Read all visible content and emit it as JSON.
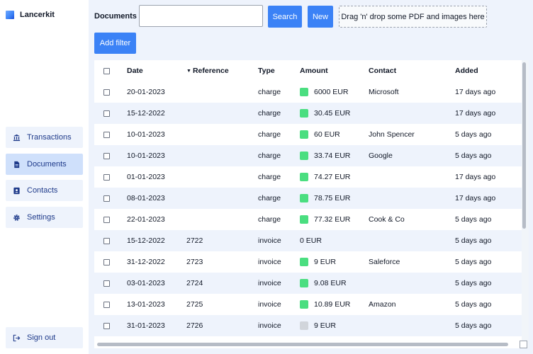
{
  "app": {
    "name": "Lancerkit"
  },
  "sidebar": {
    "items": [
      {
        "label": "Transactions",
        "icon": "bank-icon",
        "active": false
      },
      {
        "label": "Documents",
        "icon": "document-icon",
        "active": true
      },
      {
        "label": "Contacts",
        "icon": "contact-card-icon",
        "active": false
      },
      {
        "label": "Settings",
        "icon": "gear-icon",
        "active": false
      }
    ],
    "signout": {
      "label": "Sign out",
      "icon": "sign-out-icon"
    }
  },
  "toolbar": {
    "title": "Documents",
    "search_value": "",
    "search_label": "Search",
    "new_label": "New",
    "dropzone_text": "Drag 'n' drop some PDF and images here",
    "filter_label": "Add filter"
  },
  "table": {
    "columns": [
      "Date",
      "Reference",
      "Type",
      "Amount",
      "Contact",
      "Added"
    ],
    "sorted_column": "Reference",
    "rows": [
      {
        "date": "20-01-2023",
        "reference": "",
        "type": "charge",
        "amount": "6000 EUR",
        "status": "green",
        "contact": "Microsoft",
        "added": "17 days ago"
      },
      {
        "date": "15-12-2022",
        "reference": "",
        "type": "charge",
        "amount": "30.45 EUR",
        "status": "green",
        "contact": "",
        "added": "17 days ago"
      },
      {
        "date": "10-01-2023",
        "reference": "",
        "type": "charge",
        "amount": "60 EUR",
        "status": "green",
        "contact": "John Spencer",
        "added": "5 days ago"
      },
      {
        "date": "10-01-2023",
        "reference": "",
        "type": "charge",
        "amount": "33.74 EUR",
        "status": "green",
        "contact": "Google",
        "added": "5 days ago"
      },
      {
        "date": "01-01-2023",
        "reference": "",
        "type": "charge",
        "amount": "74.27 EUR",
        "status": "green",
        "contact": "",
        "added": "17 days ago"
      },
      {
        "date": "08-01-2023",
        "reference": "",
        "type": "charge",
        "amount": "78.75 EUR",
        "status": "green",
        "contact": "",
        "added": "17 days ago"
      },
      {
        "date": "22-01-2023",
        "reference": "",
        "type": "charge",
        "amount": "77.32 EUR",
        "status": "green",
        "contact": "Cook & Co",
        "added": "5 days ago"
      },
      {
        "date": "15-12-2022",
        "reference": "2722",
        "type": "invoice",
        "amount": "0 EUR",
        "status": "none",
        "contact": "",
        "added": "5 days ago"
      },
      {
        "date": "31-12-2022",
        "reference": "2723",
        "type": "invoice",
        "amount": "9 EUR",
        "status": "green",
        "contact": "Saleforce",
        "added": "5 days ago"
      },
      {
        "date": "03-01-2023",
        "reference": "2724",
        "type": "invoice",
        "amount": "9.08 EUR",
        "status": "green",
        "contact": "",
        "added": "5 days ago"
      },
      {
        "date": "13-01-2023",
        "reference": "2725",
        "type": "invoice",
        "amount": "10.89 EUR",
        "status": "green",
        "contact": "Amazon",
        "added": "5 days ago"
      },
      {
        "date": "31-01-2023",
        "reference": "2726",
        "type": "invoice",
        "amount": "9 EUR",
        "status": "gray",
        "contact": "",
        "added": "5 days ago"
      }
    ]
  },
  "colors": {
    "accent": "#3b82f6",
    "status_green": "#4ade80",
    "status_gray": "#d1d5db",
    "row_stripe": "#eef3fc",
    "nav_active": "#cfe0fb"
  }
}
